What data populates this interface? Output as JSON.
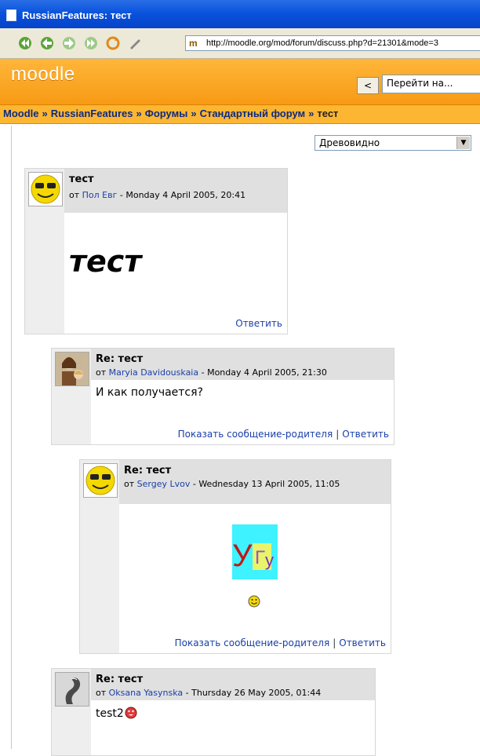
{
  "window": {
    "title": "RussianFeatures: тест"
  },
  "browser": {
    "url": "http://moodle.org/mod/forum/discuss.php?d=21301&mode=3",
    "toolbar_icons": [
      "back-start-icon",
      "back-arrow-icon",
      "forward-arrow-icon",
      "forward-end-icon",
      "refresh-icon",
      "edit-icon"
    ]
  },
  "header": {
    "logo": "moodle",
    "jump_button": "<",
    "jump_select": "Перейти на..."
  },
  "breadcrumb": {
    "items": [
      "Moodle",
      "RussianFeatures",
      "Форумы",
      "Стандартный форум"
    ],
    "current": "тест",
    "separator": "»"
  },
  "display_mode": {
    "selected": "Древовидно"
  },
  "posts": [
    {
      "subject": "тест",
      "by_prefix": "от",
      "author": "Пол Евг",
      "date": "- Monday 4 April 2005, 20:41",
      "message": "тест",
      "reply_link": "Ответить"
    },
    {
      "subject": "Re: тест",
      "by_prefix": "от",
      "author": "Maryia Davidouskaia",
      "date": "- Monday 4 April 2005, 21:30",
      "message": "И как получается?",
      "parent_link": "Показать сообщение-родителя",
      "separator": "|",
      "reply_link": "Ответить"
    },
    {
      "subject": "Re: тест",
      "by_prefix": "от",
      "author": "Sergey Lvov",
      "date": "- Wednesday 13 April 2005, 11:05",
      "image_text_1": "У",
      "image_text_2": "Г",
      "image_text_3": "у",
      "parent_link": "Показать сообщение-родителя",
      "separator": "|",
      "reply_link": "Ответить"
    },
    {
      "subject": "Re: тест",
      "by_prefix": "от",
      "author": "Oksana Yasynska",
      "date": "- Thursday 26 May 2005, 01:44",
      "message": "test2"
    }
  ],
  "colors": {
    "header_orange": "#f79a14",
    "navbar_orange": "#fdb632",
    "link_blue": "#1a3fa8",
    "titlebar_blue": "#0a53dc"
  }
}
